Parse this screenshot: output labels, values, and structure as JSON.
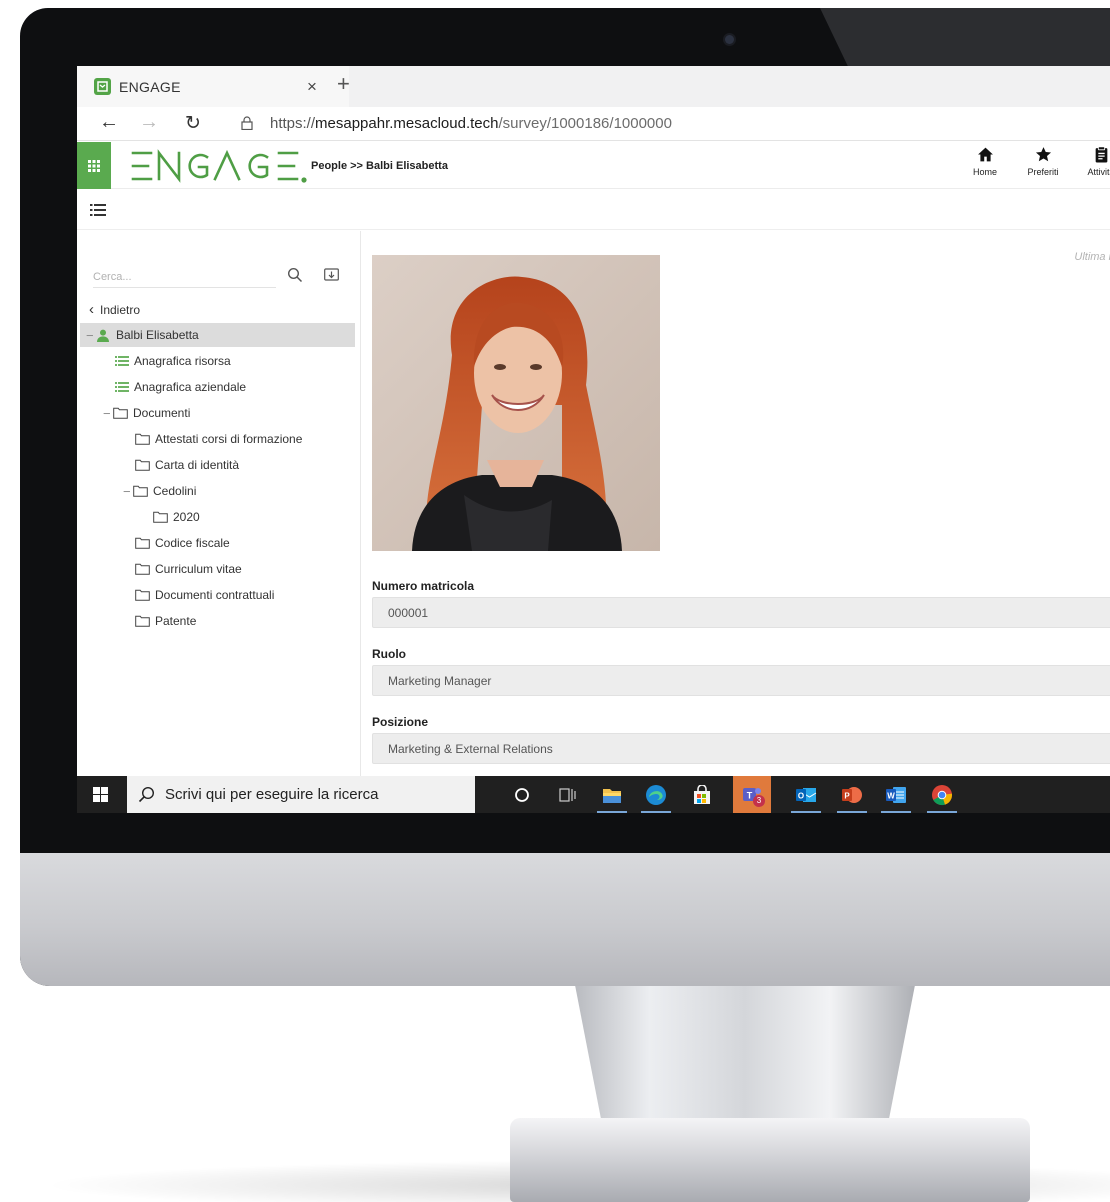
{
  "browser": {
    "tab_title": "ENGAGE",
    "url_scheme": "https://",
    "url_host": "mesappahr.mesacloud.tech",
    "url_path": "/survey/1000186/1000000"
  },
  "app": {
    "logo_text": "ENGAGE",
    "breadcrumb": "People >> Balbi Elisabetta",
    "toolbar": [
      {
        "label": "Home",
        "icon": "home-icon"
      },
      {
        "label": "Preferiti",
        "icon": "star-icon"
      },
      {
        "label": "Attività",
        "icon": "clipboard-icon"
      }
    ],
    "accent_color": "#5aaa4f"
  },
  "sidebar": {
    "search_placeholder": "Cerca...",
    "back_label": "Indietro",
    "tree": [
      {
        "label": "Balbi Elisabetta",
        "icon": "user-icon",
        "level": 0,
        "selected": true,
        "expanded": true
      },
      {
        "label": "Anagrafica risorsa",
        "icon": "list-icon",
        "level": 1
      },
      {
        "label": "Anagrafica aziendale",
        "icon": "list-icon",
        "level": 1
      },
      {
        "label": "Documenti",
        "icon": "folder-icon",
        "level": 1,
        "expanded": true
      },
      {
        "label": "Attestati corsi di formazione",
        "icon": "folder-icon",
        "level": 2
      },
      {
        "label": "Carta di identità",
        "icon": "folder-icon",
        "level": 2
      },
      {
        "label": "Cedolini",
        "icon": "folder-icon",
        "level": 2,
        "expanded": true
      },
      {
        "label": "2020",
        "icon": "folder-icon",
        "level": 3
      },
      {
        "label": "Codice fiscale",
        "icon": "folder-icon",
        "level": 2
      },
      {
        "label": "Curriculum vitae",
        "icon": "folder-icon",
        "level": 2
      },
      {
        "label": "Documenti contrattuali",
        "icon": "folder-icon",
        "level": 2
      },
      {
        "label": "Patente",
        "icon": "folder-icon",
        "level": 2
      }
    ]
  },
  "content": {
    "last_modified_label": "Ultima mod",
    "fields": [
      {
        "label": "Numero matricola",
        "value": "000001"
      },
      {
        "label": "Ruolo",
        "value": "Marketing Manager"
      },
      {
        "label": "Posizione",
        "value": "Marketing & External Relations"
      }
    ]
  },
  "taskbar": {
    "search_text": "Scrivi qui per eseguire la ricerca",
    "teams_badge": "3"
  }
}
